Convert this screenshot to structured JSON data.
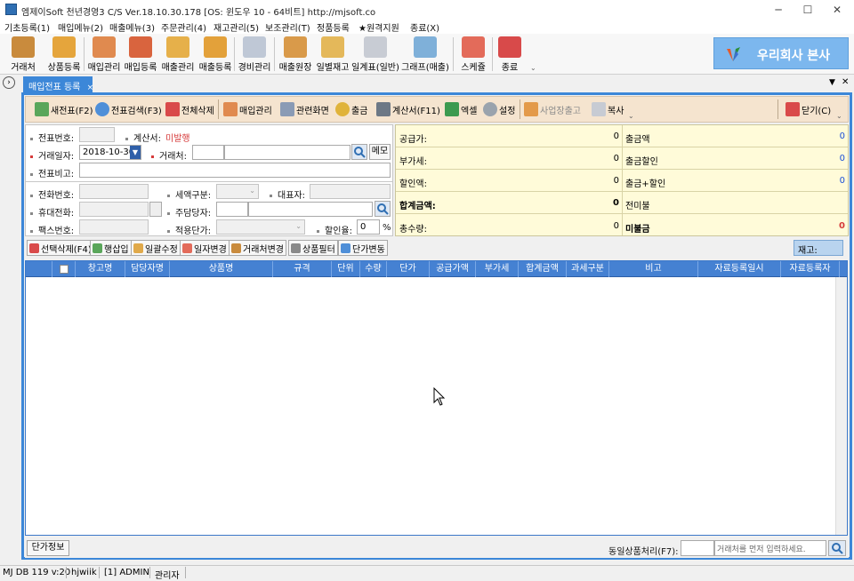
{
  "window": {
    "title": "엠제이Soft 천년경영3 C/S  Ver.18.10.30.178  [OS: 윈도우 10 - 64비트]   http://mjsoft.co"
  },
  "menu": [
    "기초등록(1)",
    "매입메뉴(2)",
    "매출메뉴(3)",
    "주문관리(4)",
    "재고관리(5)",
    "보조관리(T)",
    "정품등록",
    "★원격지원",
    "종료(X)"
  ],
  "toolbar": [
    "거래처",
    "상품등록",
    "매입관리",
    "매입등록",
    "매출관리",
    "매출등록",
    "경비관리",
    "매출원장",
    "일별재고",
    "일계표(일반)",
    "그래프(매출)",
    "스케쥴",
    "종료"
  ],
  "company": "우리회사 본사",
  "tab": {
    "label": "매입전표 등록"
  },
  "actions": [
    "새전표(F2)",
    "전표검색(F3)",
    "전체삭제",
    "매입관리",
    "관련화면",
    "출금",
    "계산서(F11)",
    "엑셀",
    "설정",
    "사업장출고",
    "복사",
    "닫기(C)"
  ],
  "form": {
    "voucher_no": "전표번호:",
    "invoice": "계산서:",
    "invoice_value": "미발행",
    "date_label": "거래일자:",
    "date_value": "2018-10-30",
    "client": "거래처:",
    "memo": "메모",
    "remark": "전표비고:",
    "phone": "전화번호:",
    "tax_type": "세액구분:",
    "ceo": "대표자:",
    "mobile": "휴대전화:",
    "manager": "주담당자:",
    "fax": "팩스번호:",
    "price_type": "적용단가:",
    "discount": "할인율:",
    "discount_value": "0",
    "percent": "%"
  },
  "summary": {
    "left": [
      {
        "label": "공급가:",
        "value": "0"
      },
      {
        "label": "부가세:",
        "value": "0"
      },
      {
        "label": "할인액:",
        "value": "0"
      },
      {
        "label": "합계금액:",
        "value": "0"
      },
      {
        "label": "총수량:",
        "value": "0"
      }
    ],
    "right": [
      {
        "label": "출금액",
        "value": "0"
      },
      {
        "label": "출금할인",
        "value": "0"
      },
      {
        "label": "출금+할인",
        "value": "0"
      },
      {
        "label": "전미불",
        "value": ""
      },
      {
        "label": "미불금",
        "value": "0"
      }
    ]
  },
  "grid_buttons": [
    "선택삭제(F4)",
    "행삽입",
    "일괄수정",
    "일자변경",
    "거래처변경",
    "상품필터",
    "단가변동"
  ],
  "stock_label": "재고:",
  "columns": [
    "창고명",
    "담당자명",
    "상품명",
    "규격",
    "단위",
    "수량",
    "단가",
    "공급가액",
    "부가세",
    "합계금액",
    "과세구분",
    "비고",
    "자료등록일시",
    "자료등록자"
  ],
  "bottom": {
    "price_info": "단가정보",
    "same_item": "동일상품처리(F7):",
    "placeholder": "거래처를 먼저 입력하세요."
  },
  "status": [
    "MJ DB 119 v:20",
    "hjwiik",
    "[1] ADMIN",
    "관리자"
  ],
  "colors": {
    "accent": "#3c87d8",
    "header": "#4581d2",
    "toolbar_bg": "#f5e4cf",
    "summary_bg": "#fffbd9",
    "alert": "#d63a3a",
    "value_blue": "#1d4fd6"
  }
}
